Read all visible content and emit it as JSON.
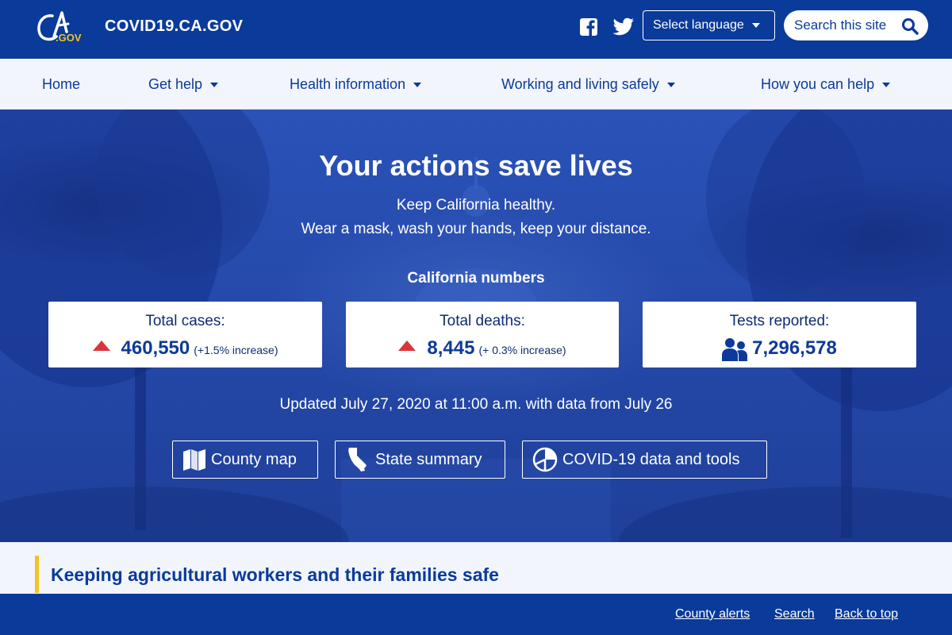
{
  "header": {
    "logo_text": "CA.GOV",
    "site_name": "COVID19.CA.GOV",
    "language_label": "Select language",
    "search_label": "Search this site"
  },
  "nav": {
    "items": [
      {
        "label": "Home",
        "dropdown": false
      },
      {
        "label": "Get help",
        "dropdown": true
      },
      {
        "label": "Health information",
        "dropdown": true
      },
      {
        "label": "Working and living safely",
        "dropdown": true
      },
      {
        "label": "How you can help",
        "dropdown": true
      }
    ]
  },
  "hero": {
    "title": "Your actions save lives",
    "subtitle_line1": "Keep California healthy.",
    "subtitle_line2": "Wear a mask, wash your hands, keep your distance.",
    "numbers_heading": "California numbers",
    "stats": [
      {
        "label": "Total cases:",
        "value": "460,550",
        "change": "(+1.5% increase)",
        "icon": "arrow-up-triangle"
      },
      {
        "label": "Total deaths:",
        "value": "8,445",
        "change": "(+ 0.3% increase)",
        "icon": "arrow-up-triangle"
      },
      {
        "label": "Tests reported:",
        "value": "7,296,578",
        "icon": "people-icon"
      }
    ],
    "updated": "Updated July 27, 2020 at 11:00 a.m. with data from July 26",
    "buttons": [
      {
        "label": "County map",
        "icon": "map-icon"
      },
      {
        "label": "State summary",
        "icon": "california-icon"
      },
      {
        "label": "COVID-19 data and tools",
        "icon": "pie-chart-icon"
      }
    ]
  },
  "feature": {
    "title": "Keeping agricultural workers and their families safe"
  },
  "footer": {
    "links": [
      "County alerts",
      "Search",
      "Back to top"
    ]
  },
  "colors": {
    "brand_blue": "#0a3a9a",
    "accent_gold": "#f3c41f",
    "alert_red": "#d9353a",
    "nav_bg": "#f2f5fc"
  }
}
